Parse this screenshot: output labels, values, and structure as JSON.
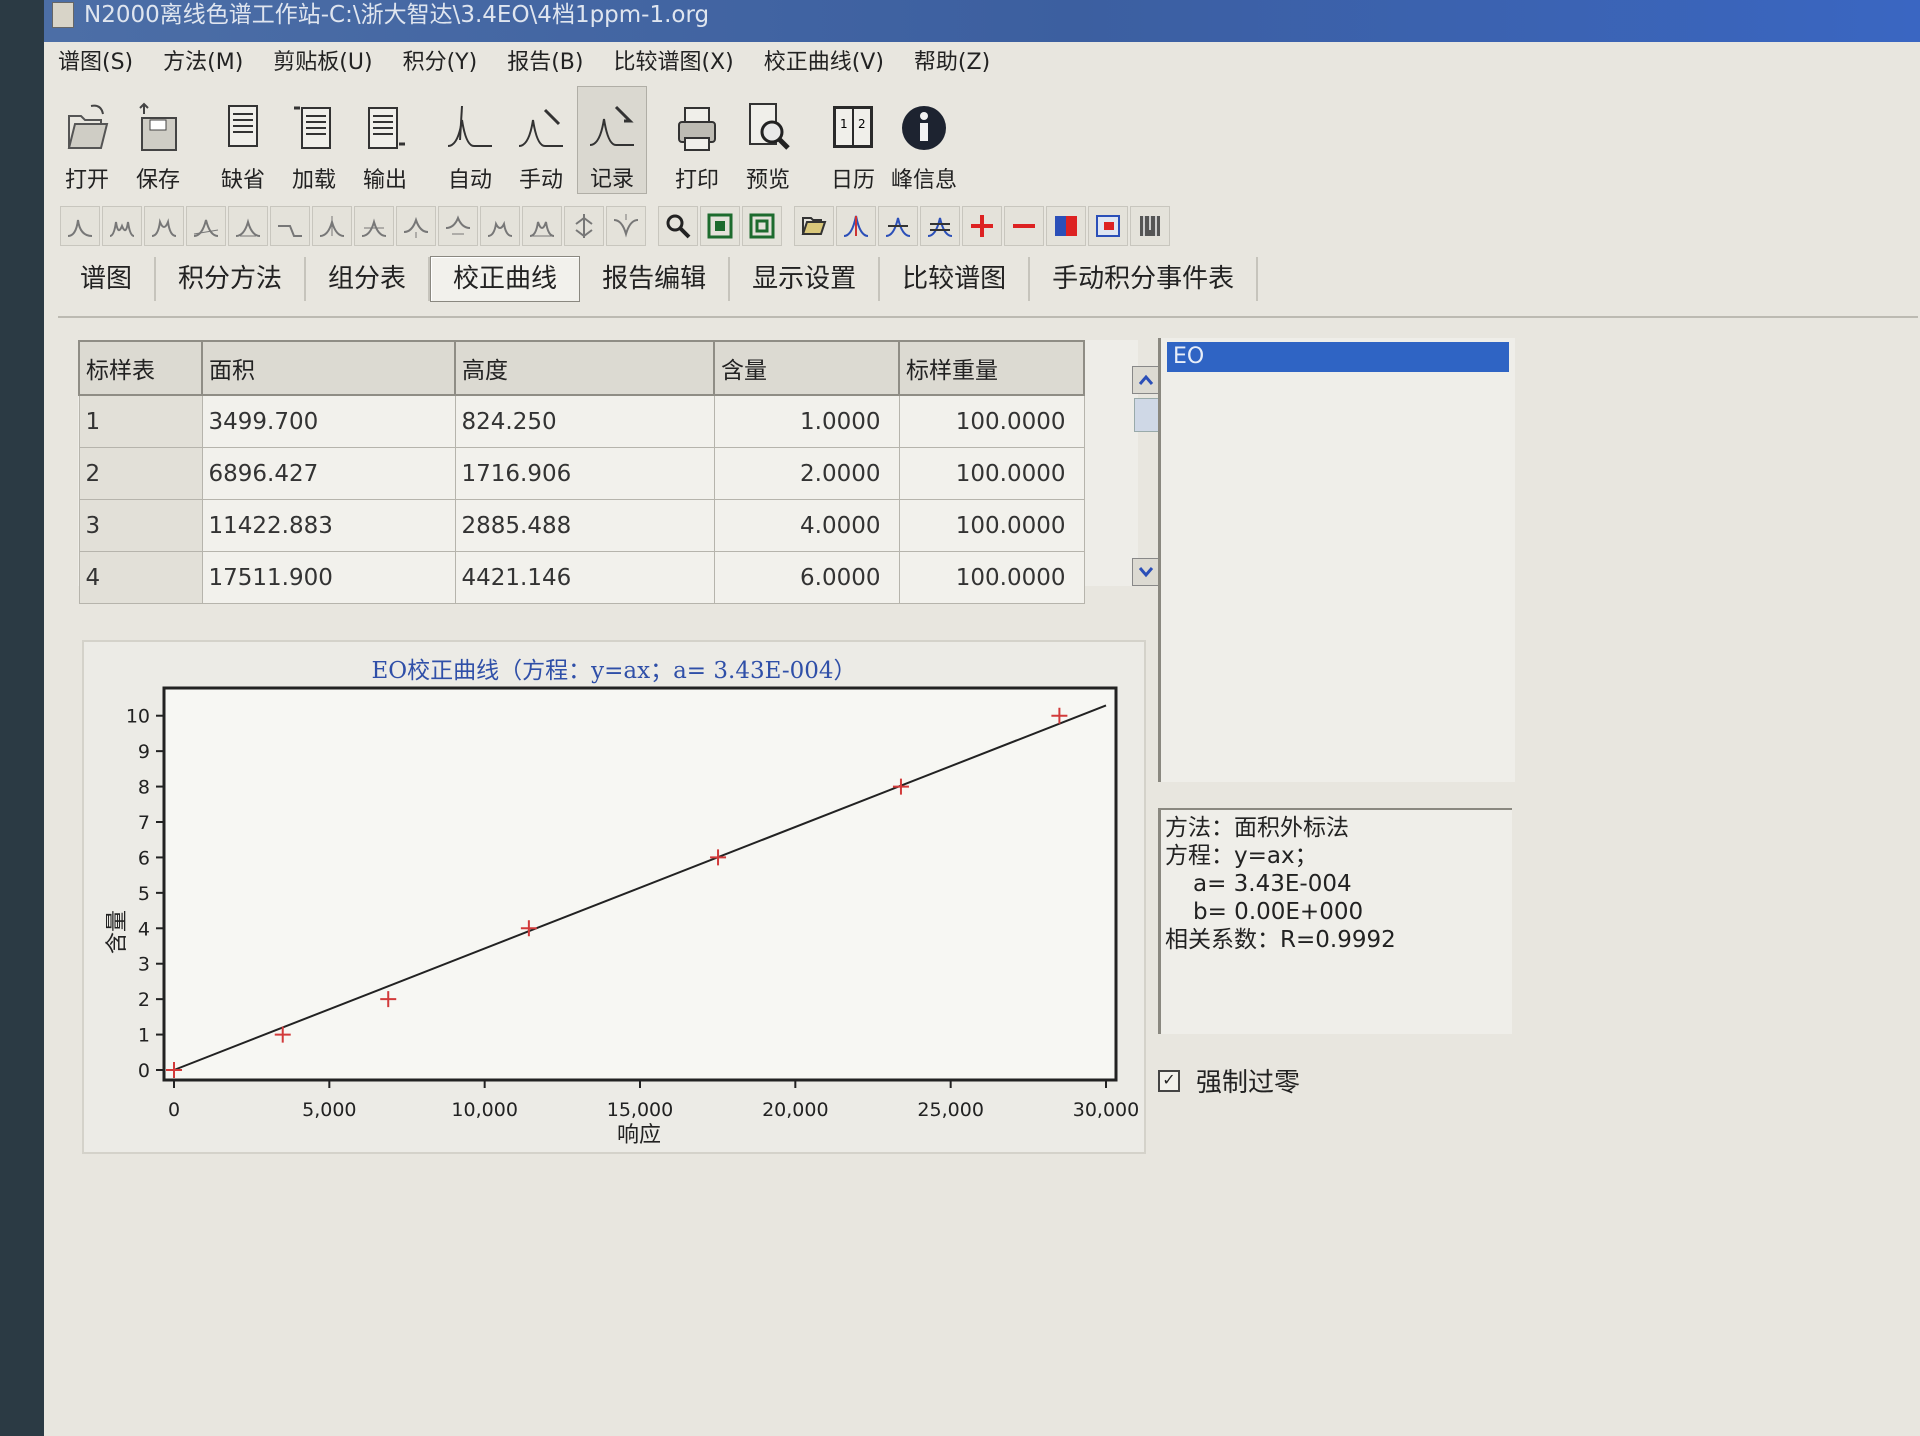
{
  "window": {
    "title": "N2000离线色谱工作站-C:\\浙大智达\\3.4EO\\4档1ppm-1.org"
  },
  "menu": [
    "谱图(S)",
    "方法(M)",
    "剪贴板(U)",
    "积分(Y)",
    "报告(B)",
    "比较谱图(X)",
    "校正曲线(V)",
    "帮助(Z)"
  ],
  "toolbar": {
    "open": "打开",
    "save": "保存",
    "default": "缺省",
    "load": "加载",
    "export": "输出",
    "auto": "自动",
    "manual": "手动",
    "record": "记录",
    "print": "打印",
    "preview": "预览",
    "calendar": "日历",
    "peak_info": "峰信息"
  },
  "tabs": [
    "谱图",
    "积分方法",
    "组分表",
    "校正曲线",
    "报告编辑",
    "显示设置",
    "比较谱图",
    "手动积分事件表"
  ],
  "active_tab": "校正曲线",
  "table": {
    "headers": [
      "标样表",
      "面积",
      "高度",
      "含量",
      "标样重量"
    ],
    "rows": [
      [
        "1",
        "3499.700",
        "824.250",
        "1.0000",
        "100.0000"
      ],
      [
        "2",
        "6896.427",
        "1716.906",
        "2.0000",
        "100.0000"
      ],
      [
        "3",
        "11422.883",
        "2885.488",
        "4.0000",
        "100.0000"
      ],
      [
        "4",
        "17511.900",
        "4421.146",
        "6.0000",
        "100.0000"
      ]
    ]
  },
  "components": [
    "EO"
  ],
  "info": {
    "method": "方法：面积外标法",
    "equation": "方程：y=ax；",
    "a": "a= 3.43E-004",
    "b": "b= 0.00E+000",
    "r": "相关系数：R=0.9992"
  },
  "force_zero": {
    "label": "强制过零",
    "checked": true
  },
  "colors": {
    "line": "#222222",
    "marker": "#d23a3a",
    "title": "#2f4fa8",
    "selection": "#2f64c4"
  },
  "chart_data": {
    "type": "scatter",
    "title": "EO校正曲线（方程：y=ax；a= 3.43E-004）",
    "xlabel": "响应",
    "ylabel": "含量",
    "xlim": [
      0,
      30000
    ],
    "ylim": [
      0,
      10.5
    ],
    "x_ticks": [
      0,
      5000,
      10000,
      15000,
      20000,
      25000,
      30000
    ],
    "x_tick_labels": [
      "0",
      "5,000",
      "10,000",
      "15,000",
      "20,000",
      "25,000",
      "30,000"
    ],
    "y_ticks": [
      0,
      1,
      2,
      3,
      4,
      5,
      6,
      7,
      8,
      9,
      10
    ],
    "y_tick_labels": [
      "0",
      "1",
      "2",
      "3",
      "4",
      "5",
      "6",
      "7",
      "8",
      "9",
      "10"
    ],
    "points": [
      {
        "x": 0,
        "y": 0
      },
      {
        "x": 3500,
        "y": 1
      },
      {
        "x": 6896,
        "y": 2
      },
      {
        "x": 11423,
        "y": 4
      },
      {
        "x": 17512,
        "y": 6
      },
      {
        "x": 23400,
        "y": 8
      },
      {
        "x": 28500,
        "y": 10
      }
    ],
    "fit_line": {
      "x": [
        0,
        30000
      ],
      "y": [
        0,
        10.29
      ]
    }
  }
}
